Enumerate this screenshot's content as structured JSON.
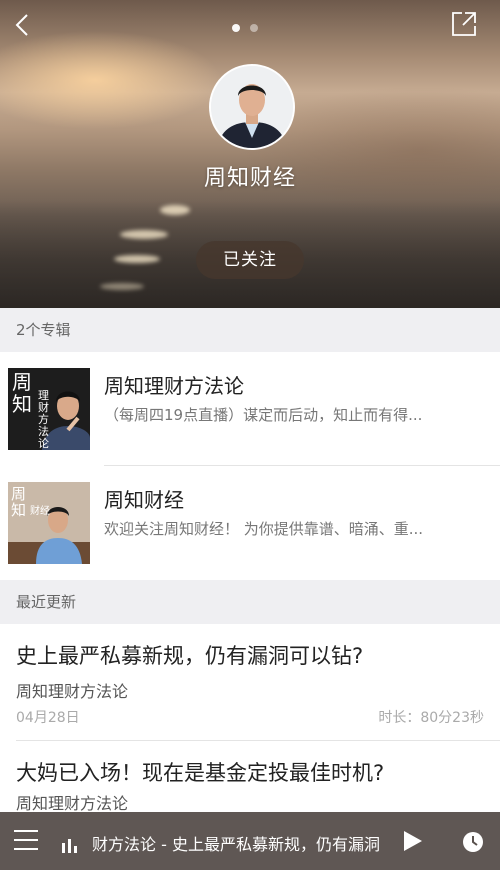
{
  "header": {
    "channel_name": "周知财经",
    "follow_label": "已关注",
    "pager_count": 2,
    "pager_active": 0
  },
  "albums_section": {
    "header": "2个专辑",
    "items": [
      {
        "title": "周知理财方法论",
        "description": "（每周四19点直播）谋定而后动，知止而有得...",
        "cover_text": [
          "周",
          "知",
          "理",
          "财",
          "方",
          "法",
          "论"
        ]
      },
      {
        "title": "周知财经",
        "description": "欢迎关注周知财经！ 为你提供靠谱、暗涌、重...",
        "cover_text": [
          "周",
          "知",
          "财",
          "经"
        ]
      }
    ]
  },
  "recent_section": {
    "header": "最近更新",
    "tracks": [
      {
        "title": "史上最严私募新规，仍有漏洞可以钻?",
        "album": "周知理财方法论",
        "date": "04月28日",
        "duration": "时长：80分23秒"
      },
      {
        "title": "大妈已入场！现在是基金定投最佳时机?",
        "album": "周知理财方法论"
      }
    ]
  },
  "player": {
    "now_playing": "财方法论 - 史上最严私募新规，仍有漏洞"
  },
  "icons": {
    "back": "chevron-left-icon",
    "share": "share-icon",
    "menu": "menu-icon",
    "bars": "playlist-bars-icon",
    "play": "play-icon",
    "clock": "clock-icon"
  },
  "colors": {
    "section_bg": "#efeff2",
    "player_bg": "#5a524e",
    "follow_bg": "#46372d"
  }
}
